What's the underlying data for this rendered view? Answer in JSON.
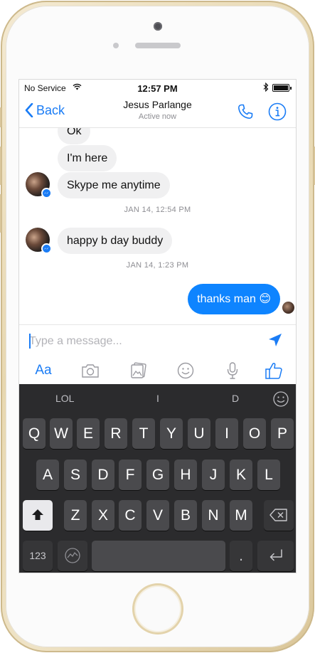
{
  "status_bar": {
    "carrier": "No Service",
    "wifi_icon": "wifi-icon",
    "time": "12:57 PM",
    "bluetooth_icon": "bluetooth-icon",
    "battery_level": 1.0
  },
  "nav": {
    "back_label": "Back",
    "title": "Jesus Parlange",
    "subtitle": "Active now",
    "icons": [
      "phone-icon",
      "info-icon"
    ]
  },
  "conversation": {
    "messages": [
      {
        "direction": "in",
        "text": "Ok"
      },
      {
        "direction": "in",
        "text": "I'm here"
      },
      {
        "direction": "in",
        "text": "Skype me anytime"
      },
      {
        "direction": "in",
        "text": "happy b day buddy"
      },
      {
        "direction": "out",
        "text": "thanks man 😊"
      }
    ],
    "timestamps": [
      "JAN 14, 12:54 PM",
      "JAN 14, 1:23 PM"
    ]
  },
  "composer": {
    "placeholder": "Type a message...",
    "value": ""
  },
  "toolbar": {
    "aa_label": "Aa",
    "icons": [
      "aa-icon",
      "camera-icon",
      "gallery-icon",
      "emoji-icon",
      "microphone-icon",
      "like-icon"
    ]
  },
  "keyboard": {
    "suggestions": [
      "LOL",
      "I",
      "D"
    ],
    "row1": [
      "Q",
      "W",
      "E",
      "R",
      "T",
      "Y",
      "U",
      "I",
      "O",
      "P"
    ],
    "row2": [
      "A",
      "S",
      "D",
      "F",
      "G",
      "H",
      "J",
      "K",
      "L"
    ],
    "row3": [
      "Z",
      "X",
      "C",
      "V",
      "B",
      "N",
      "M"
    ],
    "numbers_label": "123",
    "period_label": ".",
    "accent_color": "#1a7cf5",
    "outgoing_bubble_color": "#0e84ff"
  }
}
